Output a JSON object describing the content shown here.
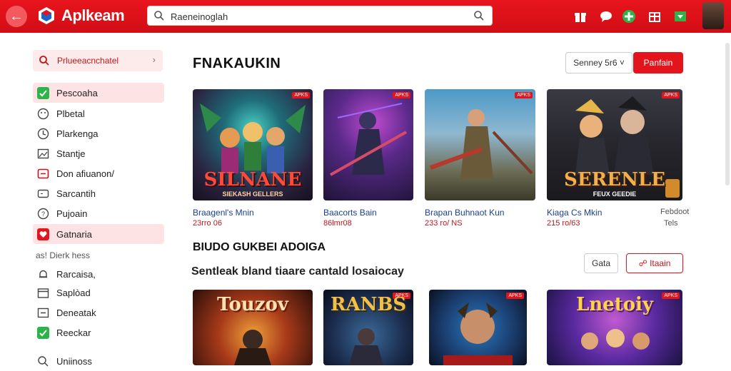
{
  "app": {
    "name": "Aplkeam"
  },
  "search": {
    "value": "Raeneinoglah"
  },
  "sidebar": {
    "search_label": "Prlueeacnchatel",
    "items": [
      {
        "label": "Pescoaha",
        "icon": "check-icon",
        "active": true
      },
      {
        "label": "Plbetal",
        "icon": "smile-icon"
      },
      {
        "label": "Plarkenga",
        "icon": "history-icon"
      },
      {
        "label": "Stantje",
        "icon": "image-icon"
      },
      {
        "label": "Don afiuanon/",
        "icon": "window-icon"
      },
      {
        "label": "Sarcantih",
        "icon": "gamepad-icon"
      },
      {
        "label": "Pujoain",
        "icon": "question-icon"
      },
      {
        "label": "Gatnaria",
        "icon": "heart-icon",
        "active": true
      },
      {
        "label": "as! Dierk hess",
        "plain": true
      },
      {
        "label": "Rarcaisa,",
        "icon": "bell-icon"
      },
      {
        "label": "Saplòad",
        "icon": "calendar-icon"
      },
      {
        "label": "Deneatak",
        "icon": "minus-box-icon"
      },
      {
        "label": "Reeckar",
        "icon": "check-icon"
      },
      {
        "label": "Uniinoss",
        "icon": "search-icon"
      }
    ]
  },
  "main": {
    "title": "FNAKAUKIN",
    "sort_label": "Senney 5r6",
    "action_label": "Panfain",
    "cards": [
      {
        "title": "Braagenl's Mnin",
        "meta": "23rro 06",
        "overlay": "SILNANE",
        "overlay2": "SIEKASH GELLERS",
        "badge": "APKS"
      },
      {
        "title": "Baacorts Bain",
        "meta": "86lmr08",
        "overlay": "",
        "overlay2": "",
        "badge": "APKS"
      },
      {
        "title": "Brapan Buhnaot Kun",
        "meta": "233 ro/ NS",
        "overlay": "",
        "overlay2": "",
        "badge": "APKS"
      },
      {
        "title": "Kiaga Cs Mkin",
        "meta": "215 ro/63",
        "overlay": "SERENLE",
        "overlay2": "FEUX GEEDIE",
        "badge": "APKS"
      }
    ],
    "cards_meta_right": {
      "title": "Febdoot",
      "meta": "Tels"
    },
    "section2_title": "BIUDO GUKBEI ADOIGA",
    "section3_title": "Sentleak bland tiaare cantald losaiocay",
    "filter_label": "Gata",
    "red_outline_label": "Itaain",
    "cards2": [
      {
        "title": "Touzov",
        "badge": ""
      },
      {
        "title": "RANBS",
        "badge": "APKS"
      },
      {
        "title": "",
        "badge": "APKS"
      },
      {
        "title": "Lnetoiy",
        "badge": "APKS"
      }
    ]
  },
  "colors": {
    "brand_red": "#e3141b",
    "link_blue": "#1b3f8f"
  }
}
